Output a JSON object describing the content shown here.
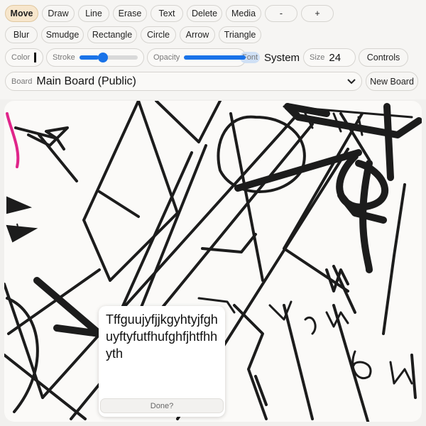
{
  "tools": {
    "row1": [
      "Move",
      "Draw",
      "Line",
      "Erase",
      "Text",
      "Delete",
      "Media",
      "-",
      "+"
    ],
    "row2": [
      "Blur",
      "Smudge",
      "Rectangle",
      "Circle",
      "Arrow",
      "Triangle"
    ]
  },
  "controls": {
    "color_label": "Color",
    "stroke_label": "Stroke",
    "stroke_value": 0.33,
    "opacity_label": "Opacity",
    "opacity_value": 1.0,
    "font_label": "Font",
    "font_value": "System",
    "size_label": "Size",
    "size_value": "24",
    "controls_button": "Controls",
    "accent_color": "#1a73e8",
    "active_tool_color": "#f7e6cc"
  },
  "board": {
    "label": "Board",
    "selected": "Main Board (Public)",
    "new_board": "New Board"
  },
  "textbox": {
    "text": "Tffguujyfjjkgyhtyjfghuyftyfutfhufghfjhtfhhyth",
    "done_label": "Done?"
  }
}
